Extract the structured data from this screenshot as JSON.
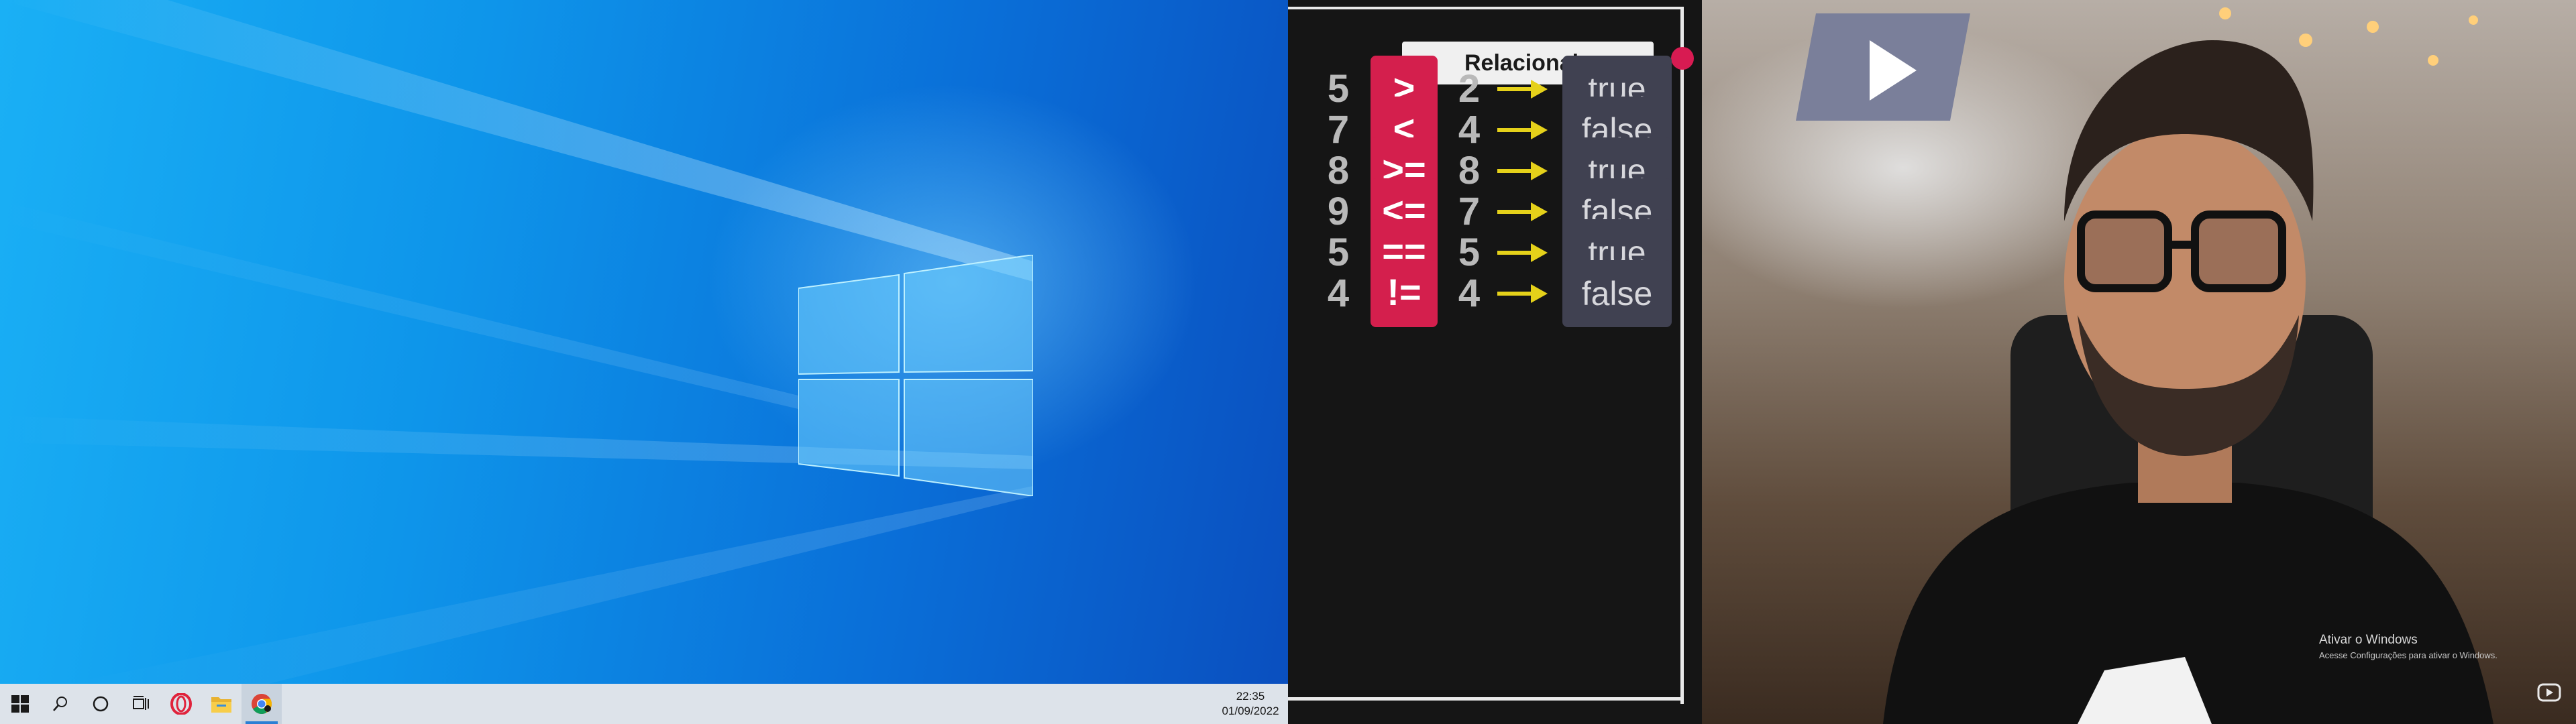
{
  "taskbar": {
    "icons": [
      "windows-start-icon",
      "search-icon",
      "cortana-icon",
      "task-view-icon",
      "opera-icon",
      "file-explorer-icon",
      "chrome-icon"
    ],
    "clock_time": "22:35",
    "clock_date": "01/09/2022"
  },
  "slide": {
    "title": "Relacionais",
    "rows": [
      {
        "lhs": "5",
        "op": ">",
        "rhs": "2",
        "result": "true"
      },
      {
        "lhs": "7",
        "op": "<",
        "rhs": "4",
        "result": "false"
      },
      {
        "lhs": "8",
        "op": ">=",
        "rhs": "8",
        "result": "true"
      },
      {
        "lhs": "9",
        "op": "<=",
        "rhs": "7",
        "result": "false"
      },
      {
        "lhs": "5",
        "op": "==",
        "rhs": "5",
        "result": "true"
      },
      {
        "lhs": "4",
        "op": "!=",
        "rhs": "4",
        "result": "false"
      }
    ]
  },
  "scene": {
    "sign_text": "Vídeo"
  },
  "watermark": {
    "line1": "Ativar o Windows",
    "line2": "Acesse Configurações para ativar o Windows."
  },
  "colors": {
    "accent_taskbar": "#2a7fd4",
    "operator_red": "#d41f4d",
    "arrow_yellow": "#e5d11a",
    "result_bg": "#404151"
  }
}
